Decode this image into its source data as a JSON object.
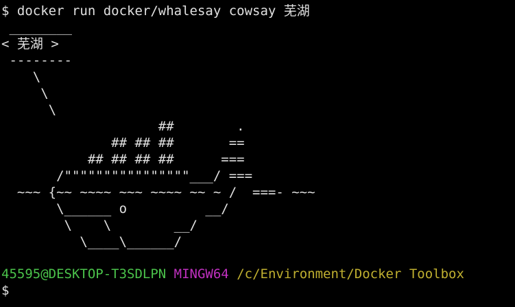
{
  "terminal": {
    "command_line": "$ docker run docker/whalesay cowsay 芜湖",
    "output_art": " ________\n< 芜湖 >\n --------\n    \\\n     \\\n      \\\n                    ##        .\n              ## ## ##       ==\n           ## ## ## ##      ===\n       /\"\"\"\"\"\"\"\"\"\"\"\"\"\"\"\"___/ ===\n  ~~~ {~~ ~~~~ ~~~ ~~~~ ~~ ~ /  ===- ~~~\n       \\______ o          __/\n        \\    \\        __/\n          \\____\\______/",
    "prompt": {
      "user_host": "45595@DESKTOP-T3SDLPN",
      "shell": "MINGW64",
      "path": "/c/Environment/Docker Toolbox"
    },
    "input_prompt": "$"
  },
  "colors": {
    "background": "#000000",
    "text": "#e0e0e0",
    "user_host": "#4bc34b",
    "shell": "#c030c0",
    "path": "#c0b030"
  }
}
